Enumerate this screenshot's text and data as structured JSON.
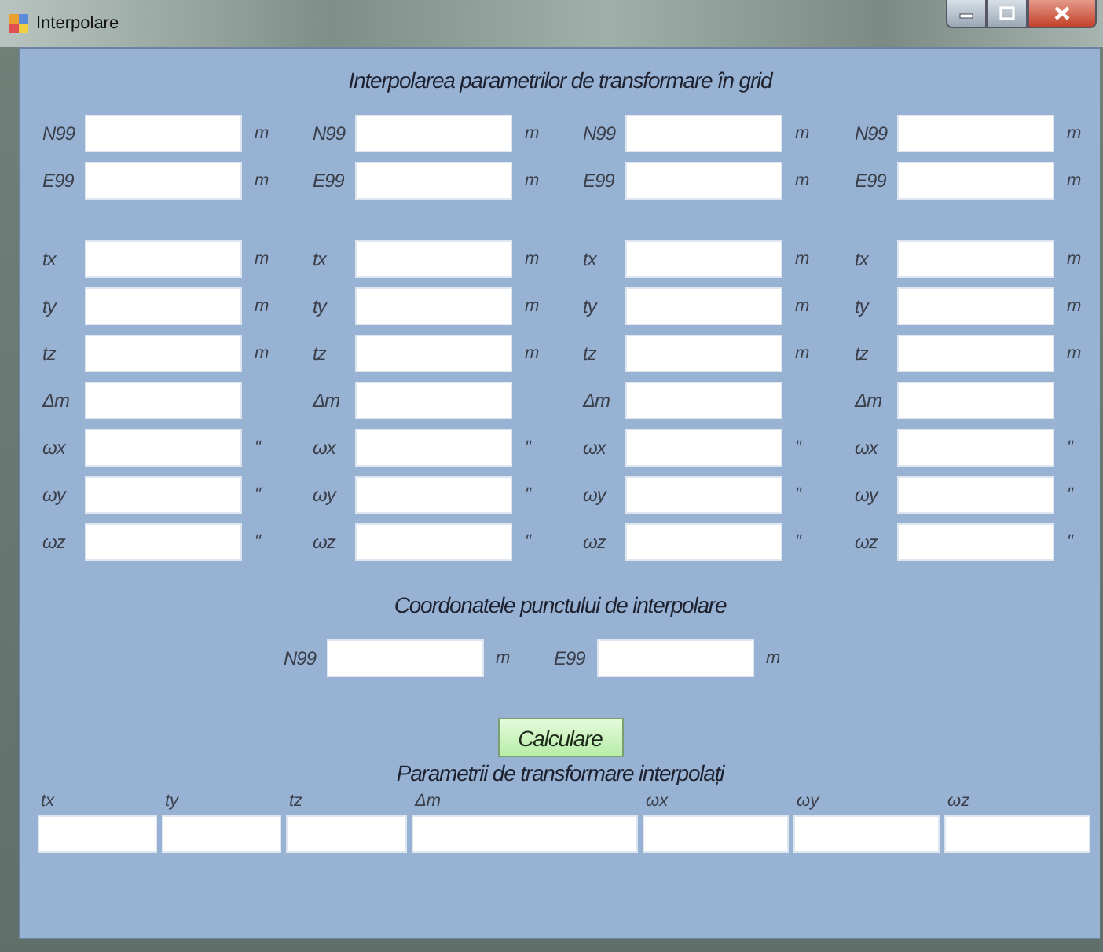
{
  "window": {
    "title": "Interpolare"
  },
  "heading": "Interpolarea parametrilor de transformare în grid",
  "grid_columns": [
    {
      "point": [
        {
          "label": "N99",
          "unit": "m"
        },
        {
          "label": "E99",
          "unit": "m"
        }
      ],
      "parameters": [
        {
          "label": "tx",
          "unit": "m"
        },
        {
          "label": "ty",
          "unit": "m"
        },
        {
          "label": "tz",
          "unit": "m"
        },
        {
          "label": "Δm"
        },
        {
          "label": "ωx",
          "unit": "\""
        },
        {
          "label": "ωy",
          "unit": "\""
        },
        {
          "label": "ωz",
          "unit": "\""
        }
      ]
    },
    {
      "point": [
        {
          "label": "N99",
          "unit": "m"
        },
        {
          "label": "E99",
          "unit": "m"
        }
      ],
      "parameters": [
        {
          "label": "tx",
          "unit": "m"
        },
        {
          "label": "ty",
          "unit": "m"
        },
        {
          "label": "tz",
          "unit": "m"
        },
        {
          "label": "Δm"
        },
        {
          "label": "ωx",
          "unit": "\""
        },
        {
          "label": "ωy",
          "unit": "\""
        },
        {
          "label": "ωz",
          "unit": "\""
        }
      ]
    },
    {
      "point": [
        {
          "label": "N99",
          "unit": "m"
        },
        {
          "label": "E99",
          "unit": "m"
        }
      ],
      "parameters": [
        {
          "label": "tx",
          "unit": "m"
        },
        {
          "label": "ty",
          "unit": "m"
        },
        {
          "label": "tz",
          "unit": "m"
        },
        {
          "label": "Δm"
        },
        {
          "label": "ωx",
          "unit": "\""
        },
        {
          "label": "ωy",
          "unit": "\""
        },
        {
          "label": "ωz",
          "unit": "\""
        }
      ]
    },
    {
      "point": [
        {
          "label": "N99",
          "unit": "m"
        },
        {
          "label": "E99",
          "unit": "m"
        }
      ],
      "parameters": [
        {
          "label": "tx",
          "unit": "m"
        },
        {
          "label": "ty",
          "unit": "m"
        },
        {
          "label": "tz",
          "unit": "m"
        },
        {
          "label": "Δm"
        },
        {
          "label": "ωx",
          "unit": "\""
        },
        {
          "label": "ωy",
          "unit": "\""
        },
        {
          "label": "ωz",
          "unit": "\""
        }
      ]
    }
  ],
  "interpolation_point": {
    "heading": "Coordonatele punctului de interpolare",
    "fields": [
      {
        "label": "N99",
        "unit": "m"
      },
      {
        "label": "E99",
        "unit": "m"
      }
    ]
  },
  "calculate_button": "Calculare",
  "results": {
    "heading": "Parametrii de transformare interpolați",
    "columns": [
      "tx",
      "ty",
      "tz",
      "Δm",
      "ωx",
      "ωy",
      "ωz"
    ]
  }
}
